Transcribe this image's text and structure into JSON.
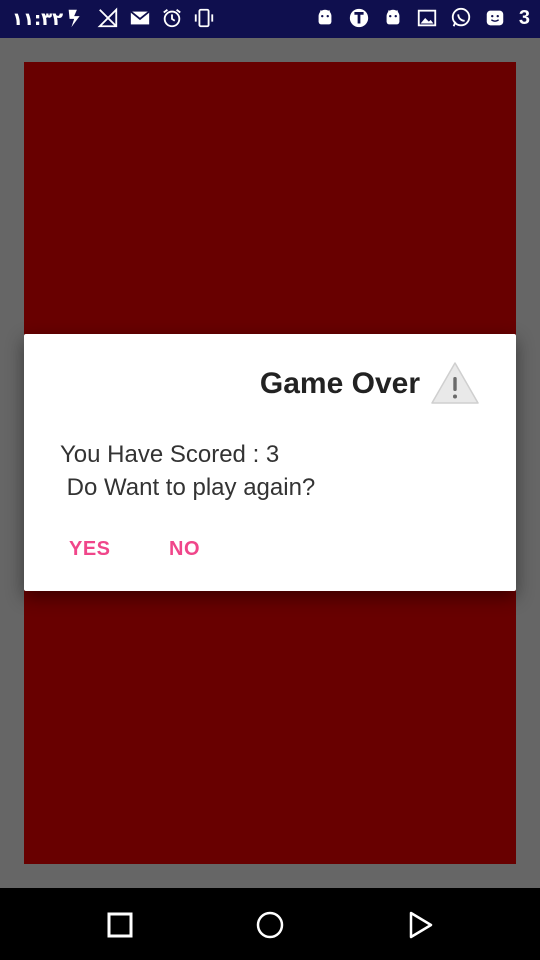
{
  "status_bar": {
    "time": "۱۱:۳۲",
    "left_icons": [
      "flash-icon",
      "signal-off-icon",
      "gmail-icon",
      "alarm-icon",
      "vibrate-icon"
    ],
    "right_icons": [
      "android-icon",
      "t-app-icon",
      "android-icon",
      "image-icon",
      "whatsapp-icon",
      "emoji-icon"
    ],
    "notification_count": "3"
  },
  "game": {
    "board_color": "#680000"
  },
  "dialog": {
    "title": "Game Over",
    "title_icon": "warning-icon",
    "message": "You Have Scored : 3\n Do Want to play again?",
    "yes_label": "YES",
    "no_label": "NO",
    "button_color": "#f0468a"
  },
  "nav_bar": {
    "buttons": [
      "back-square-icon",
      "home-circle-icon",
      "recent-play-icon"
    ]
  }
}
